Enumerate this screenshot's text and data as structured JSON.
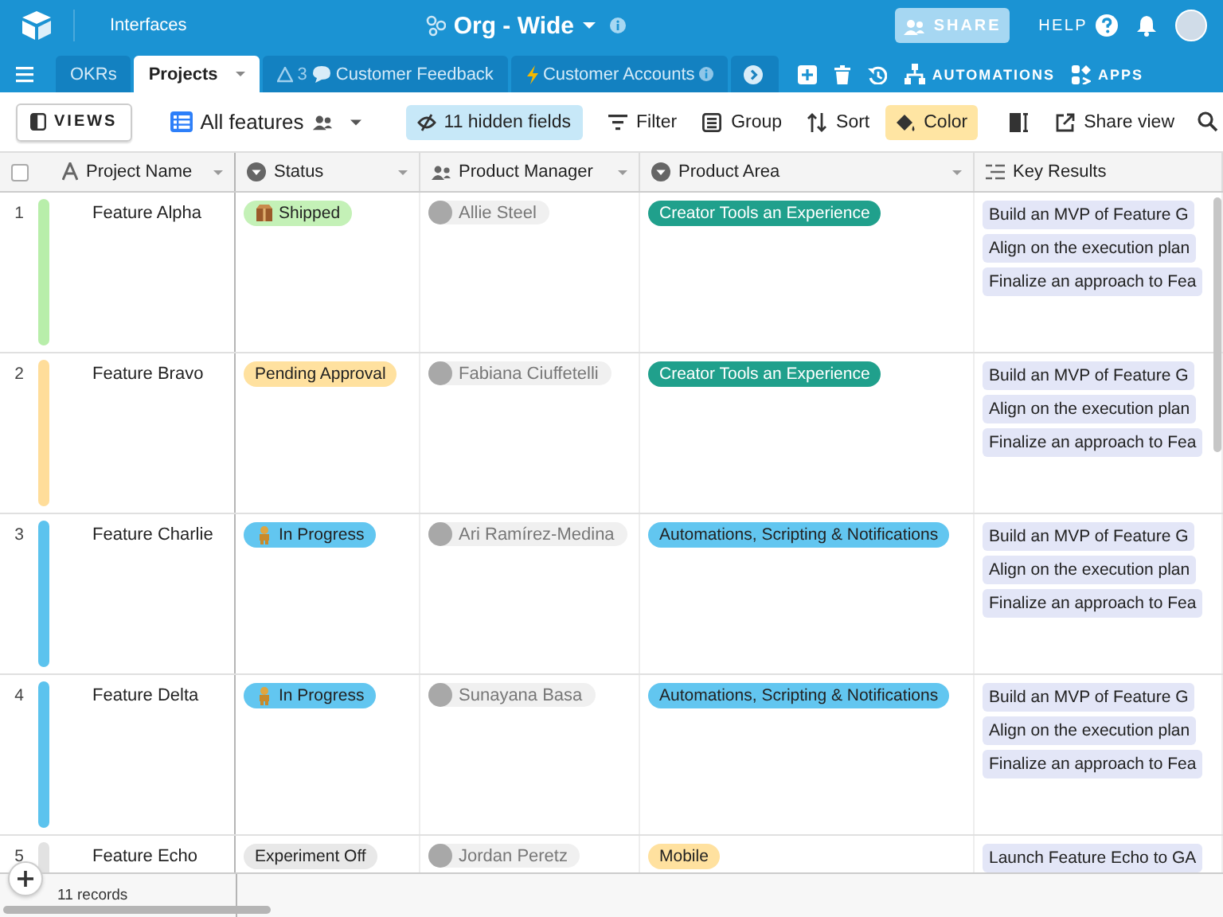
{
  "top_bar": {
    "section": "Interfaces",
    "base_title": "Org - Wide",
    "share": "SHARE",
    "help": "HELP"
  },
  "tabs": [
    {
      "kind": "menu",
      "selected": false
    },
    {
      "kind": "table",
      "label": "OKRs",
      "selected": false
    },
    {
      "kind": "table",
      "label": "Projects",
      "selected": true
    },
    {
      "kind": "feedback",
      "label": "Customer Feedback",
      "badge": "3",
      "selected": false
    },
    {
      "kind": "accounts",
      "label": "Customer Accounts",
      "selected": false
    },
    {
      "kind": "overflow",
      "selected": false
    }
  ],
  "tab_actions": [
    {
      "kind": "add"
    },
    {
      "kind": "trash"
    },
    {
      "kind": "history"
    },
    {
      "kind": "automations",
      "label": "AUTOMATIONS"
    },
    {
      "kind": "apps",
      "label": "APPS"
    }
  ],
  "toolbar": {
    "views": "VIEWS",
    "view_name": "All features",
    "hidden_fields": "11 hidden fields",
    "items": [
      {
        "kind": "filter",
        "label": "Filter",
        "active": false
      },
      {
        "kind": "group",
        "label": "Group",
        "active": false
      },
      {
        "kind": "sort",
        "label": "Sort",
        "active": false
      },
      {
        "kind": "color",
        "label": "Color",
        "active": true
      },
      {
        "kind": "row-height",
        "active": false
      },
      {
        "kind": "share",
        "label": "Share view",
        "active": false
      }
    ]
  },
  "table": {
    "select_all": {
      "checked": false
    },
    "columns": [
      {
        "kind": "text",
        "label": "Project Name"
      },
      {
        "kind": "select",
        "label": "Status"
      },
      {
        "kind": "people",
        "label": "Product Manager"
      },
      {
        "kind": "select",
        "label": "Product Area"
      },
      {
        "kind": "link",
        "label": "Key Results"
      }
    ],
    "rows": [
      {
        "number": "1",
        "color": "#b8eeaa",
        "name": "Feature Alpha",
        "status": {
          "label": "Shipped",
          "kind": "box",
          "color": "#c4f1b7"
        },
        "manager": "Allie Steel",
        "area": {
          "label": "Creator Tools an Experience",
          "color": "#20a08c"
        },
        "key_results": [
          "Build an MVP of Feature G",
          "Align on the execution plan",
          "Finalize an approach to Fea"
        ]
      },
      {
        "number": "2",
        "color": "#ffdd9a",
        "name": "Feature Bravo",
        "status": {
          "label": "Pending Approval",
          "kind": "plain",
          "color": "#ffe19f"
        },
        "manager": "Fabiana Ciuffetelli",
        "area": {
          "label": "Creator Tools an Experience",
          "color": "#20a08c"
        },
        "key_results": [
          "Build an MVP of Feature G",
          "Align on the execution plan",
          "Finalize an approach to Fea"
        ]
      },
      {
        "number": "3",
        "color": "#5cc3ee",
        "name": "Feature Charlie",
        "status": {
          "label": "In Progress",
          "kind": "figure",
          "color": "#62c6f0"
        },
        "manager": "Ari Ramírez-Medina",
        "area": {
          "label": "Automations, Scripting & Notifications",
          "color": "#62c6f0"
        },
        "key_results": [
          "Build an MVP of Feature G",
          "Align on the execution plan",
          "Finalize an approach to Fea"
        ]
      },
      {
        "number": "4",
        "color": "#5cc3ee",
        "name": "Feature Delta",
        "status": {
          "label": "In Progress",
          "kind": "figure",
          "color": "#62c6f0"
        },
        "manager": "Sunayana Basa",
        "area": {
          "label": "Automations, Scripting & Notifications",
          "color": "#62c6f0"
        },
        "key_results": [
          "Build an MVP of Feature G",
          "Align on the execution plan",
          "Finalize an approach to Fea"
        ]
      },
      {
        "number": "5",
        "color": "#e2e2e2",
        "name": "Feature Echo",
        "status": {
          "label": "Experiment Off",
          "kind": "plain",
          "color": "#e8e8e8"
        },
        "manager": "Jordan Peretz",
        "area": {
          "label": "Mobile",
          "color": "#ffe19f"
        },
        "key_results": [
          "Launch Feature Echo to GA"
        ]
      }
    ],
    "footer": {
      "count": "11 records"
    }
  }
}
